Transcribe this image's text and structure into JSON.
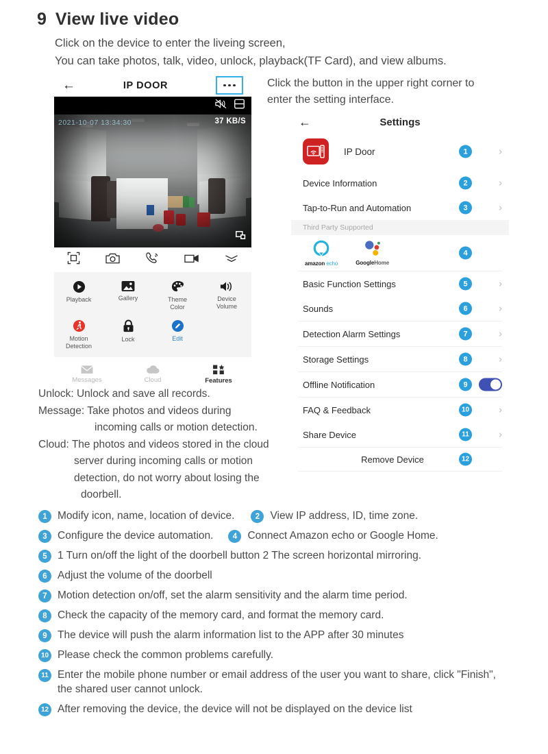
{
  "section": {
    "number": "9",
    "title": "View live video"
  },
  "intro": {
    "line1": "Click on the device to enter the liveing screen,",
    "line2": "You can take photos, talk, video, unlock, playback(TF Card), and view albums."
  },
  "right_note": {
    "line1": "Click the button in the upper right corner to",
    "line2": "enter the setting interface."
  },
  "phone": {
    "header": {
      "back_icon": "back-arrow-icon",
      "title": "IP DOOR",
      "more_icon": "more-options-icon"
    },
    "video": {
      "mute_icon": "mute-icon",
      "layout_icon": "split-view-icon",
      "bitrate": "37 KB/S",
      "timestamp": "2021-10-07 13:34:30",
      "pip_icon": "picture-in-picture-icon"
    },
    "actions": [
      {
        "name": "fullscreen-icon",
        "label": "Fullscreen"
      },
      {
        "name": "camera-icon",
        "label": "Snapshot"
      },
      {
        "name": "phone-call-icon",
        "label": "Talk"
      },
      {
        "name": "video-record-icon",
        "label": "Record"
      },
      {
        "name": "collapse-chevrons-icon",
        "label": "More"
      }
    ],
    "features": [
      {
        "label": "Playback",
        "icon": "play-circle-icon",
        "accent": "#1c1c1c"
      },
      {
        "label": "Gallery",
        "icon": "image-icon",
        "accent": "#1c1c1c"
      },
      {
        "label": "Theme\nColor",
        "icon": "palette-icon",
        "accent": "#1c1c1c"
      },
      {
        "label": "Device\nVolume",
        "icon": "speaker-icon",
        "accent": "#1c1c1c"
      },
      {
        "label": "Motion\nDetection",
        "icon": "motion-detection-icon",
        "accent": "#e8332a"
      },
      {
        "label": "Lock",
        "icon": "lock-icon",
        "accent": "#1c1c1c"
      },
      {
        "label": "Edit",
        "icon": "edit-pencil-icon",
        "accent": "#1a73c8"
      }
    ],
    "feature_labels": {
      "playback": "Playback",
      "gallery": "Gallery",
      "theme_color_l1": "Theme",
      "theme_color_l2": "Color",
      "device_volume_l1": "Device",
      "device_volume_l2": "Volume",
      "motion_l1": "Motion",
      "motion_l2": "Detection",
      "lock": "Lock",
      "edit": "Edit"
    },
    "tabs": [
      {
        "label": "Messages",
        "icon": "envelope-icon",
        "active": false
      },
      {
        "label": "Cloud",
        "icon": "cloud-icon",
        "active": false
      },
      {
        "label": "Features",
        "icon": "grid-icon",
        "active": true
      }
    ]
  },
  "settings": {
    "back_icon": "back-arrow-icon",
    "title": "Settings",
    "device": {
      "name": "IP Door",
      "icon": "doorbell-device-icon",
      "badge": "1"
    },
    "rows": [
      {
        "label": "Device Information",
        "badge": "2",
        "chevron": true
      },
      {
        "label": "Tap-to-Run and Automation",
        "badge": "3",
        "chevron": true
      }
    ],
    "third_party_header": "Third Party Supported",
    "third_party": {
      "badge": "4",
      "brands": [
        {
          "name": "amazon-echo-logo",
          "text_a": "amazon",
          "text_b": "echo"
        },
        {
          "name": "google-home-logo",
          "text_a": "Google",
          "text_b": "Home"
        }
      ]
    },
    "rows2": [
      {
        "label": "Basic Function Settings",
        "badge": "5",
        "chevron": true
      },
      {
        "label": "Sounds",
        "badge": "6",
        "chevron": true
      },
      {
        "label": "Detection Alarm Settings",
        "badge": "7",
        "chevron": true
      },
      {
        "label": "Storage Settings",
        "badge": "8",
        "chevron": true
      }
    ],
    "offline": {
      "label": "Offline Notification",
      "badge": "9",
      "toggle_on": true
    },
    "rows3": [
      {
        "label": "FAQ & Feedback",
        "badge": "10",
        "chevron": true
      },
      {
        "label": "Share Device",
        "badge": "11",
        "chevron": true
      }
    ],
    "remove": {
      "label": "Remove Device",
      "badge": "12"
    }
  },
  "left_description": {
    "l1": "Unlock: Unlock and save all records.",
    "l2": "Message: Take photos and videos during",
    "l3": "incoming calls or motion detection.",
    "l4": "Cloud: The photos and videos stored in the cloud",
    "l5": "server during incoming calls or motion",
    "l6": "detection, do not worry about losing the",
    "l7": "doorbell."
  },
  "legend": {
    "items": [
      {
        "n": "1",
        "text": "Modify icon, name, location of device."
      },
      {
        "n": "2",
        "text": "View IP address, ID, time zone."
      },
      {
        "n": "3",
        "text": "Configure the device automation."
      },
      {
        "n": "4",
        "text": "Connect Amazon echo or Google Home."
      },
      {
        "n": "5",
        "text": "1  Turn on/off the light of the doorbell button  2  The screen horizontal mirroring."
      },
      {
        "n": "6",
        "text": "Adjust the volume of the doorbell"
      },
      {
        "n": "7",
        "text": "Motion detection on/off, set the alarm sensitivity and the alarm time period."
      },
      {
        "n": "8",
        "text": "Check the capacity of the memory card, and format the memory card."
      },
      {
        "n": "9",
        "text": "The device will push the alarm information list to the APP after 30 minutes"
      },
      {
        "n": "10",
        "text": "Please check the common problems carefully."
      },
      {
        "n": "11",
        "text": "Enter the mobile phone number or email address of the user you want to share, click \"Finish\", the shared user cannot unlock."
      },
      {
        "n": "12",
        "text": "After removing the device, the device will not be displayed on the device list"
      }
    ]
  },
  "colors": {
    "badge_blue": "#2ba0dd",
    "legend_blue": "#3fa3d8",
    "toggle_indigo": "#3f51b5",
    "device_red": "#cf2222",
    "accent_border": "#35b0e8",
    "motion_red": "#e8332a",
    "edit_blue": "#1a73c8"
  }
}
